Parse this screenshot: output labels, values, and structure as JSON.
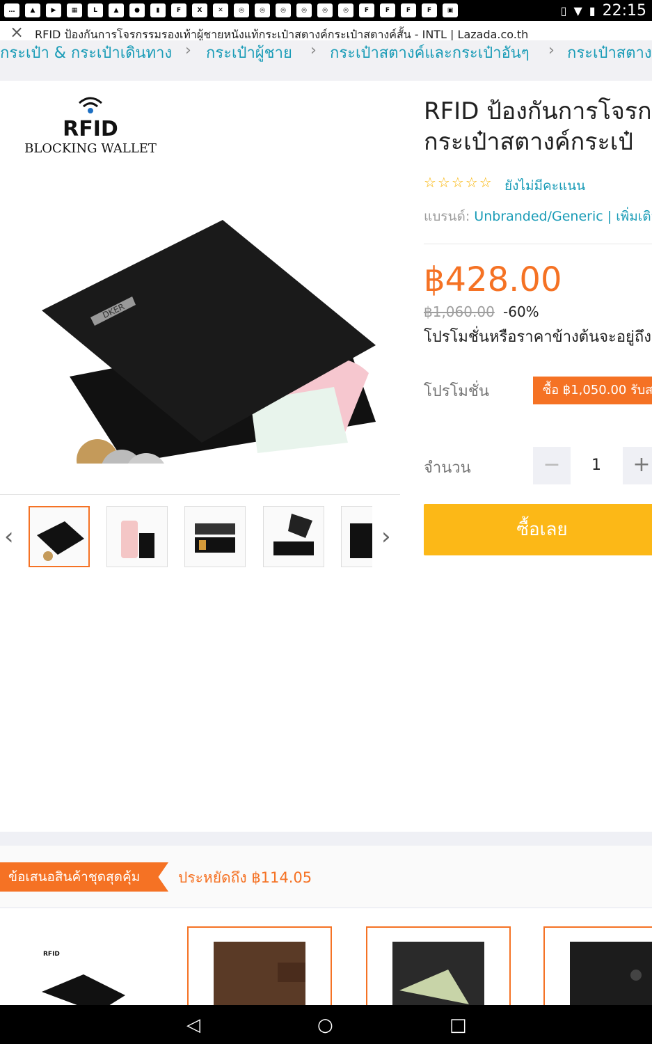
{
  "status_bar": {
    "time": "22:15",
    "notification_icons": [
      "chat-icon",
      "photo-icon",
      "video-icon",
      "grid-icon",
      "line-icon",
      "photo-icon",
      "soccer-icon",
      "stats-icon",
      "flash-icon",
      "ledx-icon",
      "x-icon",
      "chrome-icon",
      "chrome-icon",
      "chrome-icon",
      "chrome-icon",
      "chrome-icon",
      "chrome-icon",
      "flash-icon",
      "flash-icon",
      "flash-icon",
      "flash-icon",
      "box-icon",
      "x-icon",
      "translate-icon",
      "translate-icon"
    ]
  },
  "browser": {
    "page_title": "RFID ป้องกันการโจรกรรมรองเท้าผู้ชายหนังแท้กระเป๋าสตางค์กระเป๋าสตางค์สั้น - INTL | Lazada.co.th"
  },
  "breadcrumbs": [
    "กระเป๋า & กระเป๋าเดินทาง",
    "กระเป๋าผู้ชาย",
    "กระเป๋าสตางค์และกระเป๋าอันๆ",
    "กระเป๋าสตาง"
  ],
  "gallery": {
    "logo_word": "RFID",
    "logo_sub": "BLOCKING WALLET",
    "thumb_count": 5,
    "selected_thumb": 0
  },
  "product": {
    "title_line1": "RFID ป้องกันการโจรก",
    "title_line2": "กระเป๋าสตางค์กระเป๋",
    "stars": "☆☆☆☆☆",
    "rating_text": "ยังไม่มีคะแนน",
    "brand_label": "แบรนด์:",
    "brand_value": "Unbranded/Generic",
    "brand_more": "| เพิ่มเติม",
    "price": "฿428.00",
    "original_price": "฿1,060.00",
    "discount": "-60%",
    "promo_note": "โปรโมชั่นหรือราคาข้างต้นจะอยู่ถึง",
    "promo_label": "โปรโมชั่น",
    "promo_tag": "ซื้อ ฿1,050.00 รับส",
    "qty_label": "จำนวน",
    "qty_value": "1",
    "qty_minus": "−",
    "qty_plus": "+",
    "buy_now": "ซื้อเลย"
  },
  "bundle": {
    "tag": "ข้อเสนอสินค้าชุดสุดคุ้ม",
    "save_text": "ประหยัดถึง ฿114.05"
  },
  "colors": {
    "accent": "#f57224",
    "link": "#1a9cb7",
    "buy": "#fcb817"
  }
}
